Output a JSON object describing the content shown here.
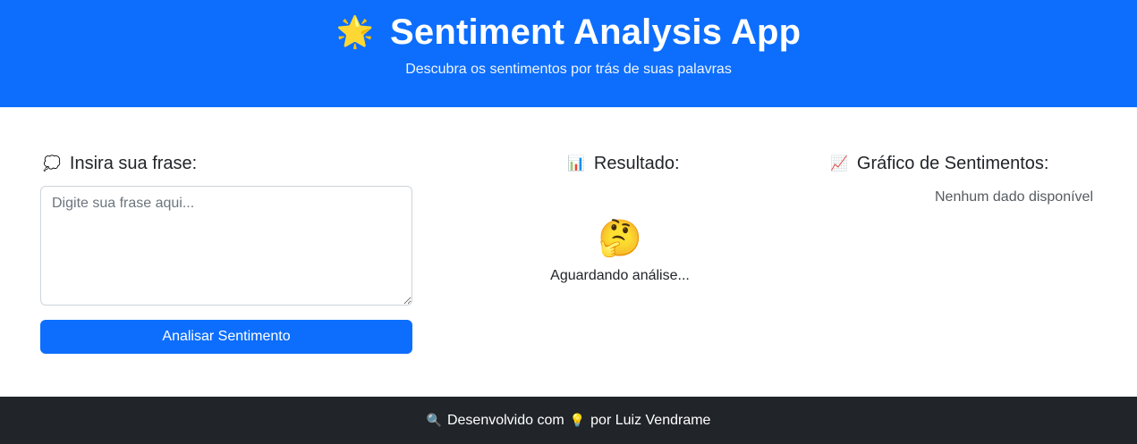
{
  "header": {
    "icon": "glowing-star-icon",
    "icon_glyph": "🌟",
    "title": "Sentiment Analysis App",
    "subtitle": "Descubra os sentimentos por trás de suas palavras"
  },
  "input_section": {
    "icon": "speech-balloon-icon",
    "icon_glyph": "💭",
    "heading": "Insira sua frase:",
    "placeholder": "Digite sua frase aqui...",
    "value": "",
    "button_label": "Analisar Sentimento"
  },
  "result_section": {
    "icon": "bar-chart-icon",
    "icon_glyph": "📊",
    "heading": "Resultado:",
    "emoji_icon": "thinking-face-icon",
    "emoji_glyph": "🤔",
    "status_text": "Aguardando análise..."
  },
  "chart_section": {
    "icon": "chart-increasing-icon",
    "icon_glyph": "📈",
    "heading": "Gráfico de Sentimentos:",
    "empty_text": "Nenhum dado disponível"
  },
  "footer": {
    "prefix": "Desenvolvido com",
    "prefix_icon_glyph": "🔍",
    "middle_icon_glyph": "💡",
    "suffix": "por Luiz Vendrame"
  },
  "colors": {
    "primary": "#0d6efd",
    "footer_bg": "#212529",
    "text": "#212529"
  }
}
